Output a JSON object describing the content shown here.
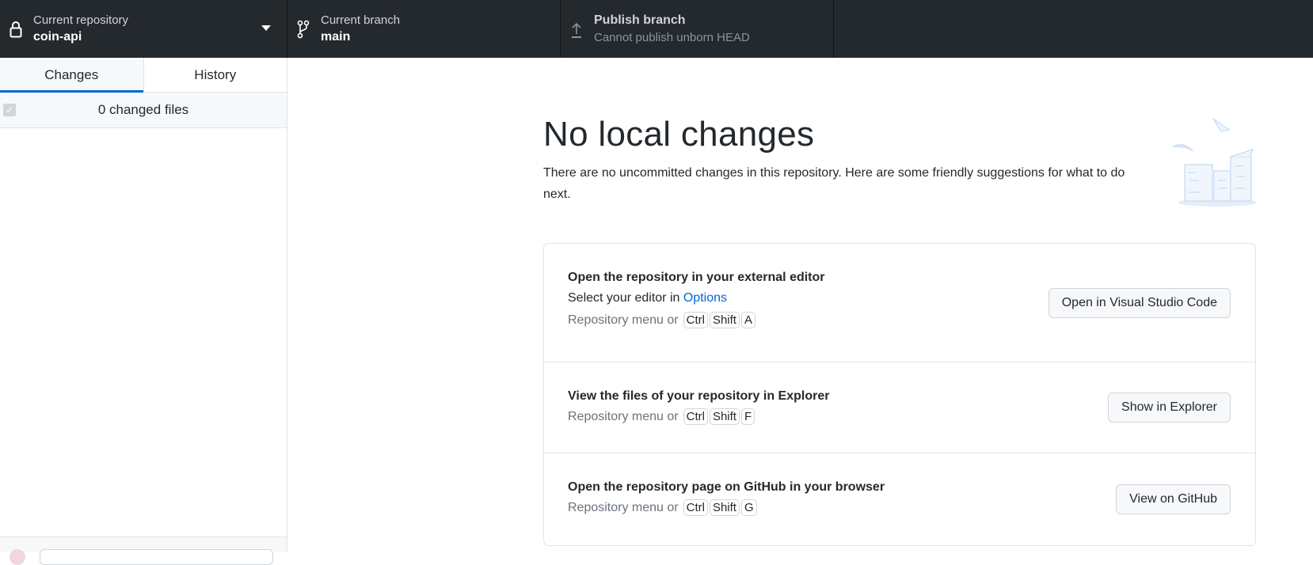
{
  "toolbar": {
    "repository": {
      "label": "Current repository",
      "value": "coin-api",
      "icon": "lock-icon"
    },
    "branch": {
      "label": "Current branch",
      "value": "main",
      "icon": "git-branch-icon"
    },
    "publish": {
      "label": "Publish branch",
      "value": "Cannot publish unborn HEAD",
      "icon": "upload-icon"
    }
  },
  "sidebar": {
    "tabs": [
      {
        "label": "Changes",
        "active": true
      },
      {
        "label": "History",
        "active": false
      }
    ],
    "changed_files": "0 changed files"
  },
  "main": {
    "title": "No local changes",
    "description": "There are no uncommitted changes in this repository. Here are some friendly suggestions for what to do next.",
    "suggestions": [
      {
        "title": "Open the repository in your external editor",
        "subtitle": "Select your editor in ",
        "link": "Options",
        "shortcut_prefix": "Repository menu or",
        "keys": [
          "Ctrl",
          "Shift",
          "A"
        ],
        "button": "Open in Visual Studio Code"
      },
      {
        "title": "View the files of your repository in Explorer",
        "shortcut_prefix": "Repository menu or",
        "keys": [
          "Ctrl",
          "Shift",
          "F"
        ],
        "button": "Show in Explorer"
      },
      {
        "title": "Open the repository page on GitHub in your browser",
        "shortcut_prefix": "Repository menu or",
        "keys": [
          "Ctrl",
          "Shift",
          "G"
        ],
        "button": "View on GitHub"
      }
    ]
  },
  "colors": {
    "toolbar": "#24292e",
    "accent": "#0366d6",
    "link": "#0366d6"
  }
}
